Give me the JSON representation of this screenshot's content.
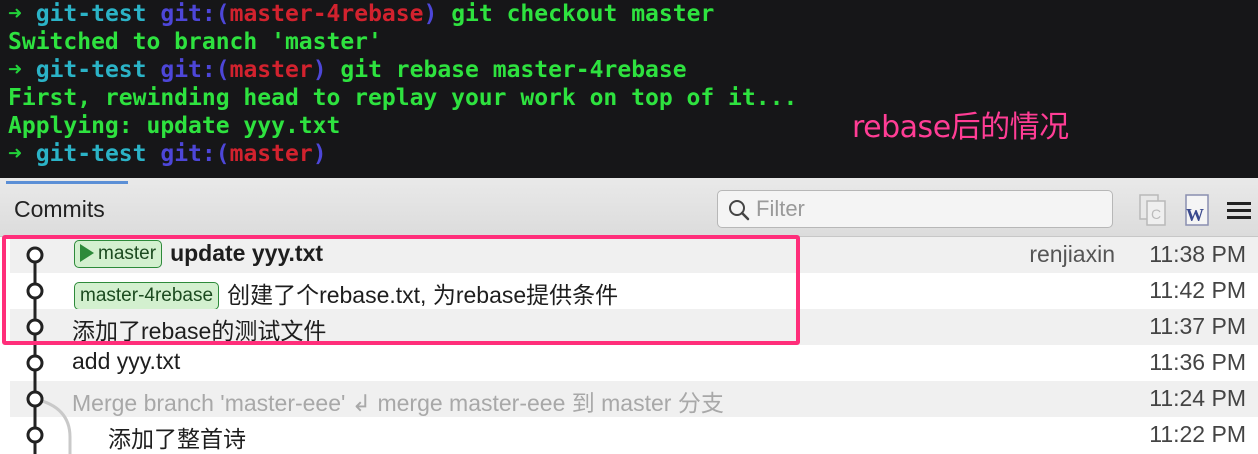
{
  "terminal": {
    "lines": [
      {
        "arrow": "➜",
        "dir": "git-test",
        "git": "git:(",
        "branch": "master-4rebase",
        "close": ")",
        "cmd": " git checkout master"
      },
      {
        "output": "Switched to branch 'master'"
      },
      {
        "arrow": "➜",
        "dir": "git-test",
        "git": "git:(",
        "branch": "master",
        "close": ")",
        "cmd": " git rebase master-4rebase"
      },
      {
        "output": "First, rewinding head to replay your work on top of it..."
      },
      {
        "output": "Applying: update yyy.txt"
      },
      {
        "arrow": "➜",
        "dir": "git-test",
        "git": "git:(",
        "branch": "master",
        "close": ")",
        "cmd": ""
      }
    ],
    "annotation": "rebase后的情况"
  },
  "toolbar": {
    "title": "Commits",
    "filter_placeholder": "Filter",
    "icons": [
      "search-icon",
      "copy-icon",
      "word-icon",
      "menu-icon"
    ]
  },
  "commits": [
    {
      "tag": "master",
      "message": "update yyy.txt",
      "author": "renjiaxin",
      "time": "11:38 PM"
    },
    {
      "tag": "master-4rebase",
      "message": "创建了个rebase.txt, 为rebase提供条件",
      "author": "",
      "time": "11:42 PM"
    },
    {
      "tag": "",
      "message": "添加了rebase的测试文件",
      "author": "",
      "time": "11:37 PM"
    },
    {
      "tag": "",
      "message": "add yyy.txt",
      "author": "",
      "time": "11:36 PM"
    },
    {
      "tag": "",
      "message": "Merge branch 'master-eee' ↲ merge master-eee 到 master 分支",
      "author": "",
      "time": "11:24 PM"
    },
    {
      "tag": "",
      "message": "添加了整首诗",
      "author": "",
      "time": "11:22 PM"
    }
  ],
  "colors": {
    "highlight": "#ff2e7a",
    "tag_border": "#2d8a3a",
    "terminal_green": "#2ee23f",
    "terminal_red": "#d2222e"
  }
}
